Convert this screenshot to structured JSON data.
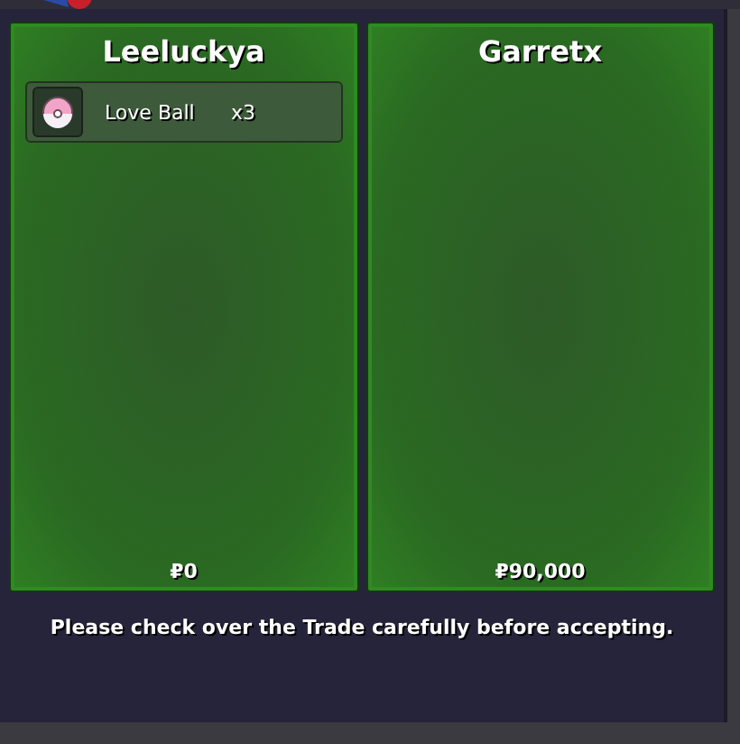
{
  "traders": [
    {
      "name": "Leeluckya",
      "items": [
        {
          "name": "Love Ball",
          "quantity": "x3"
        }
      ],
      "money": "₽0"
    },
    {
      "name": "Garretx",
      "money": "₽90,000"
    }
  ],
  "message": "Please check over the Trade carefully before accepting."
}
